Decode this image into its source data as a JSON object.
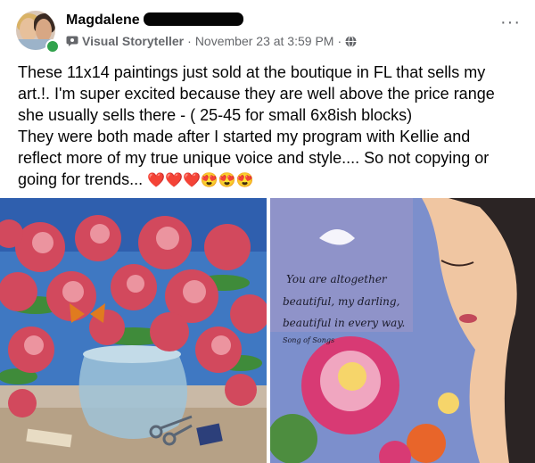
{
  "post": {
    "author_name": "Magdalene",
    "author_role": "Visual Storyteller",
    "separator": "·",
    "timestamp": "November 23 at 3:59 PM",
    "audience_icon": "globe-icon",
    "more_label": "···",
    "text_lines": [
      "These 11x14 paintings just sold at the boutique in FL that sells my",
      "art.!. I'm super excited because they are well above the price range",
      "she usually sells there - ( 25-45 for small 6x8ish blocks)",
      "They were  both made after I started my program with Kellie and",
      "reflect more of my true unique voice and style.... So not copying or",
      "going for trends..."
    ],
    "emoji_tail": "❤️❤️❤️😍😍😍"
  },
  "photos": {
    "right_painting_script": [
      "You are altogether",
      "beautiful, my darling,",
      "beautiful in every way.",
      "Song of Songs"
    ]
  },
  "colors": {
    "text_primary": "#050505",
    "text_secondary": "#65676b",
    "online_green": "#31a24c",
    "heart_red": "#e41e3f"
  }
}
